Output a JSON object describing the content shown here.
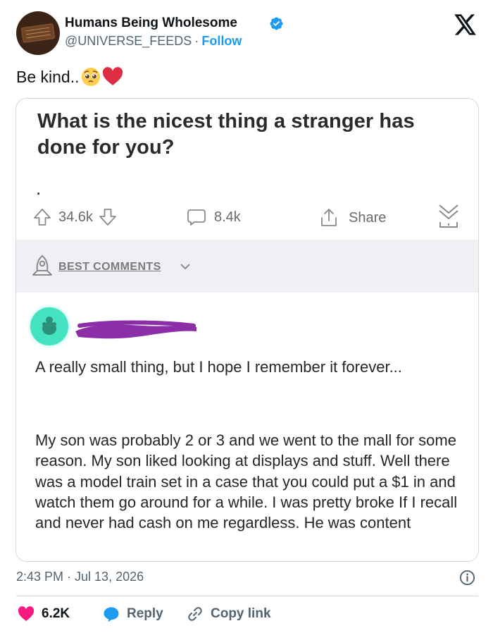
{
  "account": {
    "name": "Humans Being Wholesome",
    "handle": "@UNIVERSE_FEEDS",
    "separator": "·",
    "follow_label": "Follow"
  },
  "tweet": {
    "text": "Be kind..",
    "emojis": [
      "pleading-face-emoji",
      "red-heart-emoji"
    ]
  },
  "media": {
    "post_title": "What is the nicest thing a stranger has done for you?",
    "post_body": ".",
    "actions": {
      "upvotes": "34.6k",
      "comments": "8.4k",
      "share_label": "Share"
    },
    "best_comments_label": "BEST COMMENTS",
    "comment": {
      "lead": "A really small thing, but I hope I remember it forever...",
      "body": "My son was probably 2 or 3 and we went to the mall for some reason. My son liked looking at displays and stuff. Well there was a model train set in a case that you could put a $1 in and watch them go around for a while. I was pretty broke If I recall and never had cash on me regardless. He was content"
    }
  },
  "footer": {
    "timestamp": "2:43 PM · Jul 13, 2026",
    "likes": "6.2K",
    "reply_label": "Reply",
    "copy_link_label": "Copy link"
  },
  "colors": {
    "accent": "#1d9bf0",
    "like_heart": "#f91880",
    "muted_text": "#536471",
    "redaction": "#8b2fa8",
    "comment_avatar": "#43e3c2"
  }
}
